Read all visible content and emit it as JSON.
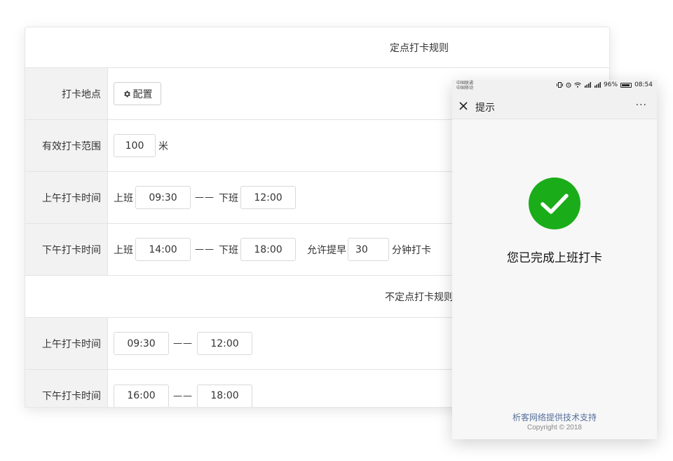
{
  "fixed_rules": {
    "title": "定点打卡规则",
    "location": {
      "label": "打卡地点",
      "config_button": "配置"
    },
    "range": {
      "label": "有效打卡范围",
      "value": "100",
      "unit": "米"
    },
    "morning": {
      "label": "上午打卡时间",
      "on_label": "上班",
      "on_time": "09:30",
      "sep": "——",
      "off_label": "下班",
      "off_time": "12:00"
    },
    "afternoon": {
      "label": "下午打卡时间",
      "on_label": "上班",
      "on_time": "14:00",
      "sep": "——",
      "off_label": "下班",
      "off_time": "18:00",
      "early_label": "允许提早",
      "early_value": "30",
      "early_unit": "分钟打卡"
    }
  },
  "flexible_rules": {
    "title": "不定点打卡规则",
    "morning": {
      "label": "上午打卡时间",
      "start": "09:30",
      "sep": "——",
      "end": "12:00"
    },
    "afternoon": {
      "label": "下午打卡时间",
      "start": "16:00",
      "sep": "——",
      "end": "18:00"
    }
  },
  "phone": {
    "status": {
      "carrier1": "中国联通",
      "carrier2": "中国移动",
      "battery": "96%",
      "time": "08:54"
    },
    "nav_title": "提示",
    "more": "···",
    "message": "您已完成上班打卡",
    "footer_link": "析客网络提供技术支持",
    "copyright": "Copyright © 2018",
    "colors": {
      "success": "#1aad19",
      "link": "#56709c"
    }
  }
}
